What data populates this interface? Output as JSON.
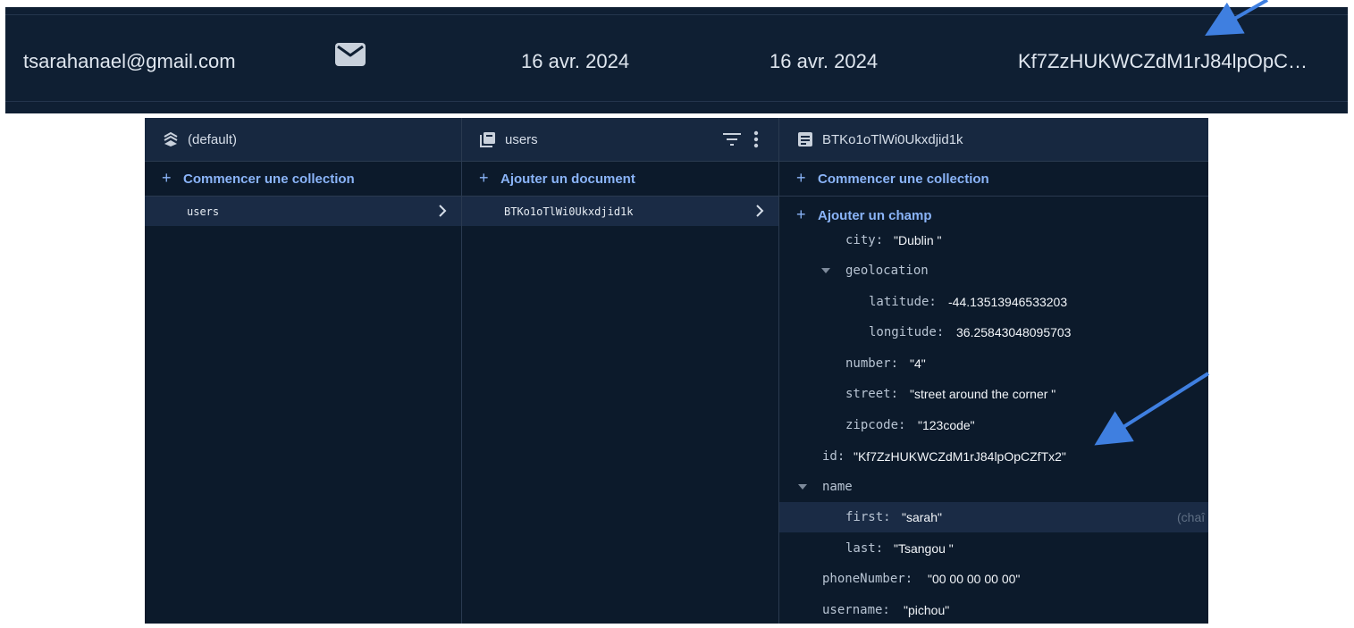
{
  "user_row": {
    "email": "tsarahanael@gmail.com",
    "provider_icon": "mail-icon",
    "created": "16 avr. 2024",
    "signed_in": "16 avr. 2024",
    "uid": "Kf7ZzHUKWCZdM1rJ84lpOpC…"
  },
  "firestore": {
    "columns": [
      {
        "icon": "database-icon",
        "title": "(default)",
        "action": "Commencer une collection",
        "selected": "users"
      },
      {
        "icon": "collection-icon",
        "title": "users",
        "action": "Ajouter un document",
        "selected": "BTKo1oTlWi0Ukxdjid1k"
      },
      {
        "icon": "document-icon",
        "title": "BTKo1oTlWi0Ukxdjid1k",
        "action": "Commencer une collection",
        "add_field": "Ajouter un champ"
      }
    ],
    "fields": [
      {
        "key": "city:",
        "value": "\"Dublin \""
      },
      {
        "key": "geolocation",
        "value": ""
      },
      {
        "key": "latitude:",
        "value": "-44.13513946533203"
      },
      {
        "key": "longitude:",
        "value": "36.25843048095703"
      },
      {
        "key": "number:",
        "value": "\"4\""
      },
      {
        "key": "street:",
        "value": "\"street around the corner \""
      },
      {
        "key": "zipcode:",
        "value": "\"123code\""
      },
      {
        "key": "id:",
        "value": "\"Kf7ZzHUKWCZdM1rJ84lpOpCZfTx2\""
      },
      {
        "key": "name",
        "value": ""
      },
      {
        "key": "first:",
        "value": "\"sarah\"",
        "type": "(chaî"
      },
      {
        "key": "last:",
        "value": "\"Tsangou \""
      },
      {
        "key": "phoneNumber:",
        "value": "\"00 00 00 00 00\""
      },
      {
        "key": "username:",
        "value": "\"pichou\""
      }
    ]
  },
  "colors": {
    "panel_bg": "#0c1a2b",
    "header_bg": "#172840",
    "accent": "#8ab4f8",
    "annotation_arrow": "#3f7fe0"
  }
}
